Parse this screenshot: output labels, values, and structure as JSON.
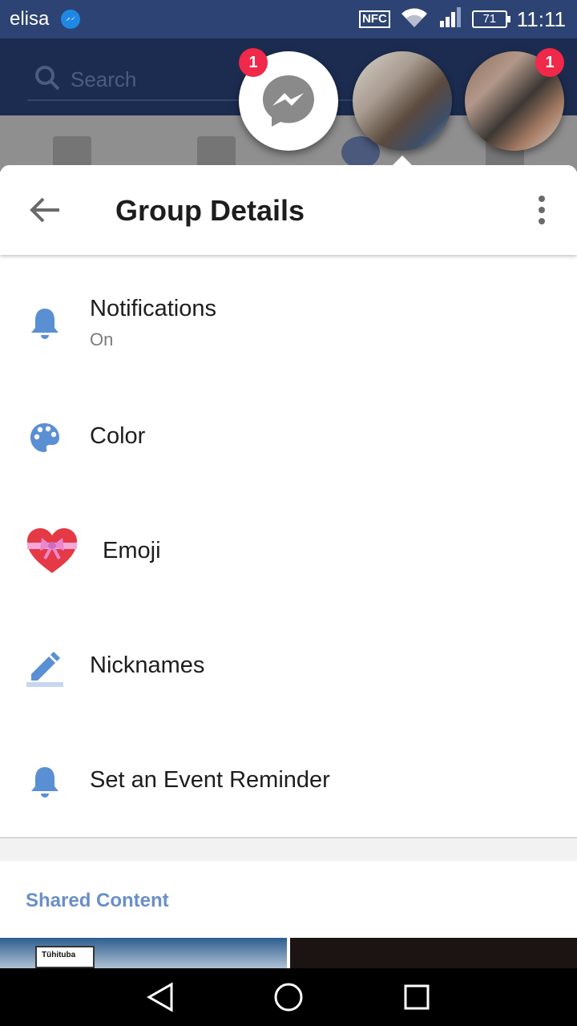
{
  "status_bar": {
    "carrier": "elisa",
    "nfc": "NFC",
    "battery": "71",
    "time": "11:11"
  },
  "background_app": {
    "search_placeholder": "Search"
  },
  "chat_heads": {
    "messenger_badge": "1",
    "contact2_badge": "1"
  },
  "toolbar": {
    "title": "Group Details"
  },
  "settings": [
    {
      "label": "Notifications",
      "sub": "On",
      "icon": "bell-icon"
    },
    {
      "label": "Color",
      "icon": "palette-icon"
    },
    {
      "label": "Emoji",
      "icon": "heart-gift-emoji"
    },
    {
      "label": "Nicknames",
      "icon": "pencil-icon"
    },
    {
      "label": "Set an Event Reminder",
      "icon": "bell-icon"
    }
  ],
  "shared_content": {
    "heading": "Shared Content",
    "thumb1_tag": "Tühituba"
  },
  "colors": {
    "accent": "#5b8fd4",
    "status_bar": "#2d4373",
    "badge": "#f02849"
  }
}
